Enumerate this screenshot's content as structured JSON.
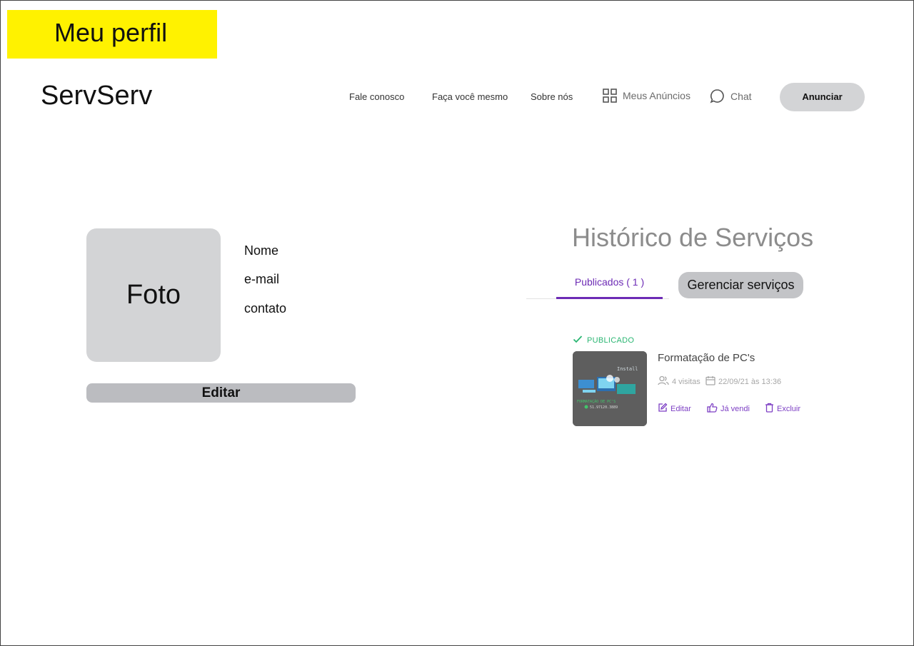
{
  "page_label": "Meu perfil",
  "brand": "ServServ",
  "nav": {
    "links": [
      "Fale conosco",
      "Faça você mesmo",
      "Sobre nós"
    ],
    "meus_anuncios": "Meus Anúncios",
    "chat": "Chat",
    "cta": "Anunciar"
  },
  "profile": {
    "photo_label": "Foto",
    "name": "Nome",
    "email": "e-mail",
    "contact": "contato",
    "edit": "Editar"
  },
  "history": {
    "title": "Histórico de Serviços",
    "tab_published": "Publicados ( 1 )",
    "manage": "Gerenciar serviços",
    "item": {
      "status": "PUBLICADO",
      "title": "Formatação de PC's",
      "visits": "4 visitas",
      "date": "22/09/21 às 13:36",
      "actions": [
        "Editar",
        "Já vendi",
        "Excluir"
      ],
      "thumb_text": {
        "install": "Install",
        "caption": "FORMATAÇÃO DE PC'S",
        "phone": "51.97120.3889"
      }
    }
  },
  "colors": {
    "highlight": "#fff200",
    "accent": "#6d2bb5",
    "status_green": "#2bb673",
    "button_grey": "#d3d4d6"
  }
}
